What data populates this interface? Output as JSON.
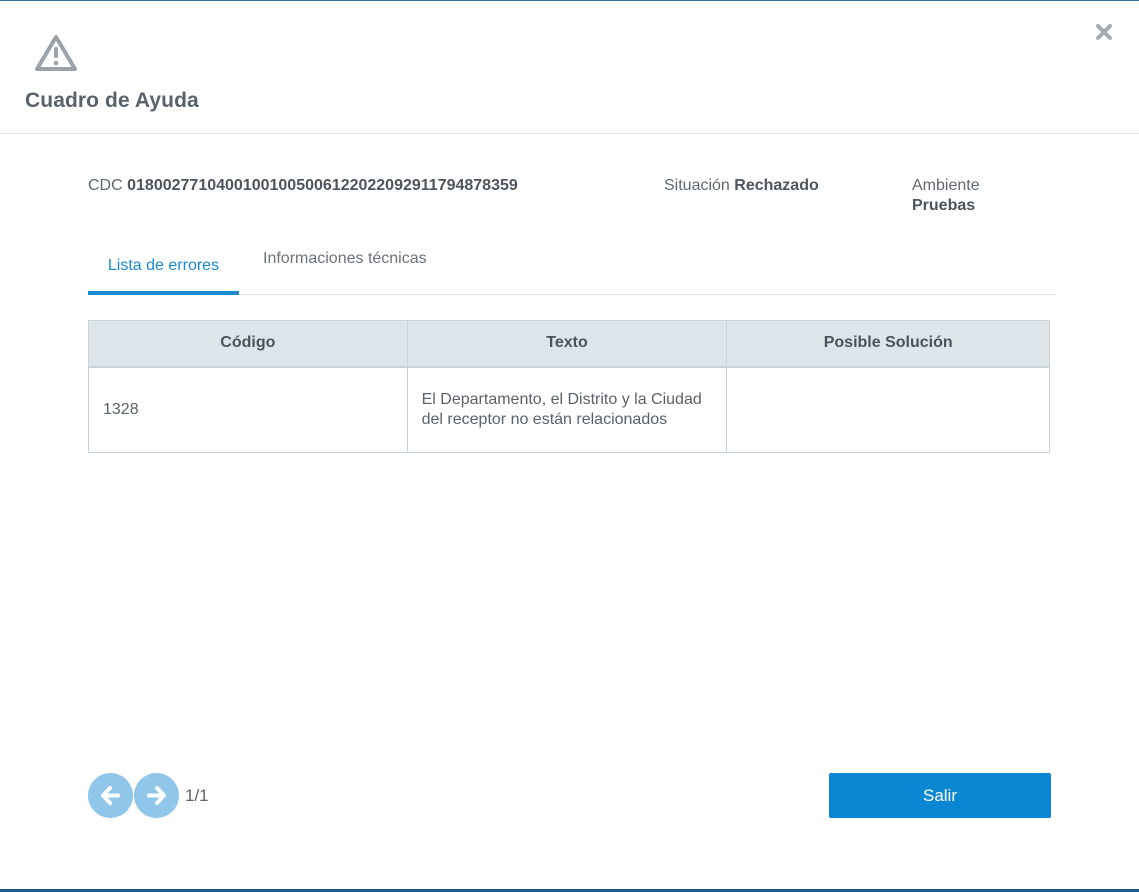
{
  "dialog": {
    "title": "Cuadro de Ayuda",
    "close_symbol": "✖"
  },
  "meta": {
    "cdc_label": "CDC",
    "cdc_value": "01800277104001001005006122022092911794878359",
    "situacion_label": "Situación",
    "situacion_value": "Rechazado",
    "ambiente_label": "Ambiente",
    "ambiente_value": "Pruebas"
  },
  "tabs": [
    {
      "label": "Lista de errores",
      "active": true
    },
    {
      "label": "Informaciones técnicas",
      "active": false
    }
  ],
  "table": {
    "headers": [
      "Código",
      "Texto",
      "Posible Solución"
    ],
    "rows": [
      {
        "codigo": "1328",
        "texto": "El Departamento, el Distrito y la Ciudad del receptor no están relacionados",
        "solucion": ""
      }
    ]
  },
  "pager": {
    "page_text": "1/1"
  },
  "footer": {
    "exit_label": "Salir"
  },
  "colors": {
    "accent": "#1a8ad3",
    "button": "#0a87d3",
    "pager_button": "#8fc6ea",
    "table_header": "#dde5ea"
  },
  "icons": [
    "warning-icon",
    "close-icon",
    "arrow-left-icon",
    "arrow-right-icon"
  ]
}
